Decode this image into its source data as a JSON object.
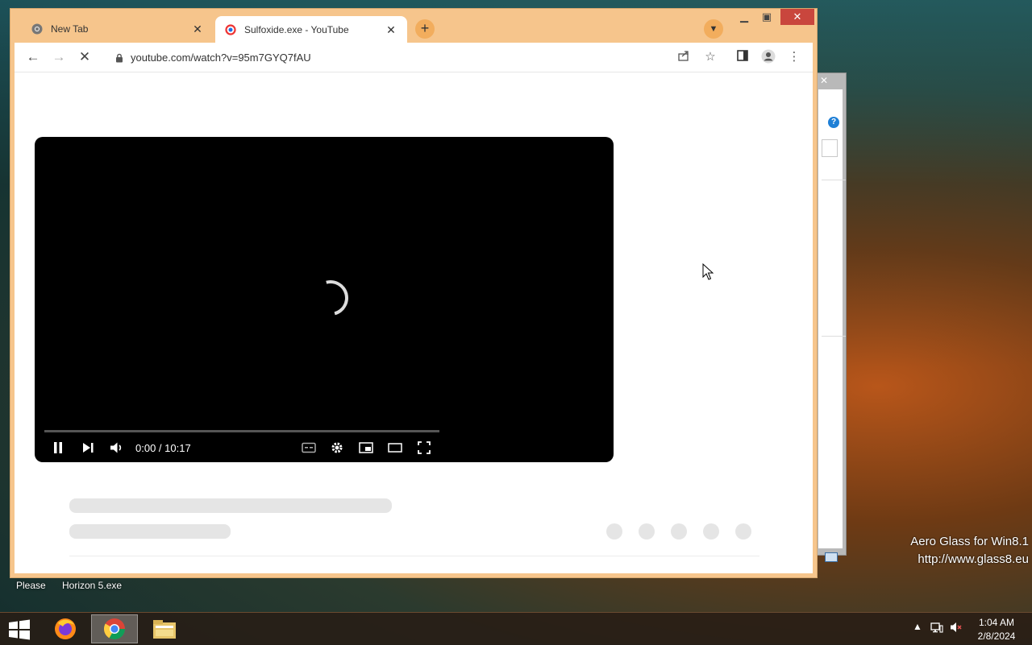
{
  "browser": {
    "tabs": [
      {
        "title": "New Tab",
        "active": false
      },
      {
        "title": "Sulfoxide.exe - YouTube",
        "active": true
      }
    ],
    "url": "youtube.com/watch?v=95m7GYQ7fAU",
    "accent_color": "#f6c58c"
  },
  "player": {
    "time_display": "0:00 / 10:17",
    "state": "loading"
  },
  "desktop": {
    "icons": [
      {
        "label": "Please"
      },
      {
        "label": "Horizon 5.exe"
      }
    ],
    "watermark_line1": "Aero Glass for Win8.1",
    "watermark_line2": "http://www.glass8.eu"
  },
  "taskbar": {
    "apps": [
      "firefox-icon",
      "chrome-icon",
      "file-explorer-icon"
    ],
    "clock_time": "1:04 AM",
    "clock_date": "2/8/2024"
  }
}
